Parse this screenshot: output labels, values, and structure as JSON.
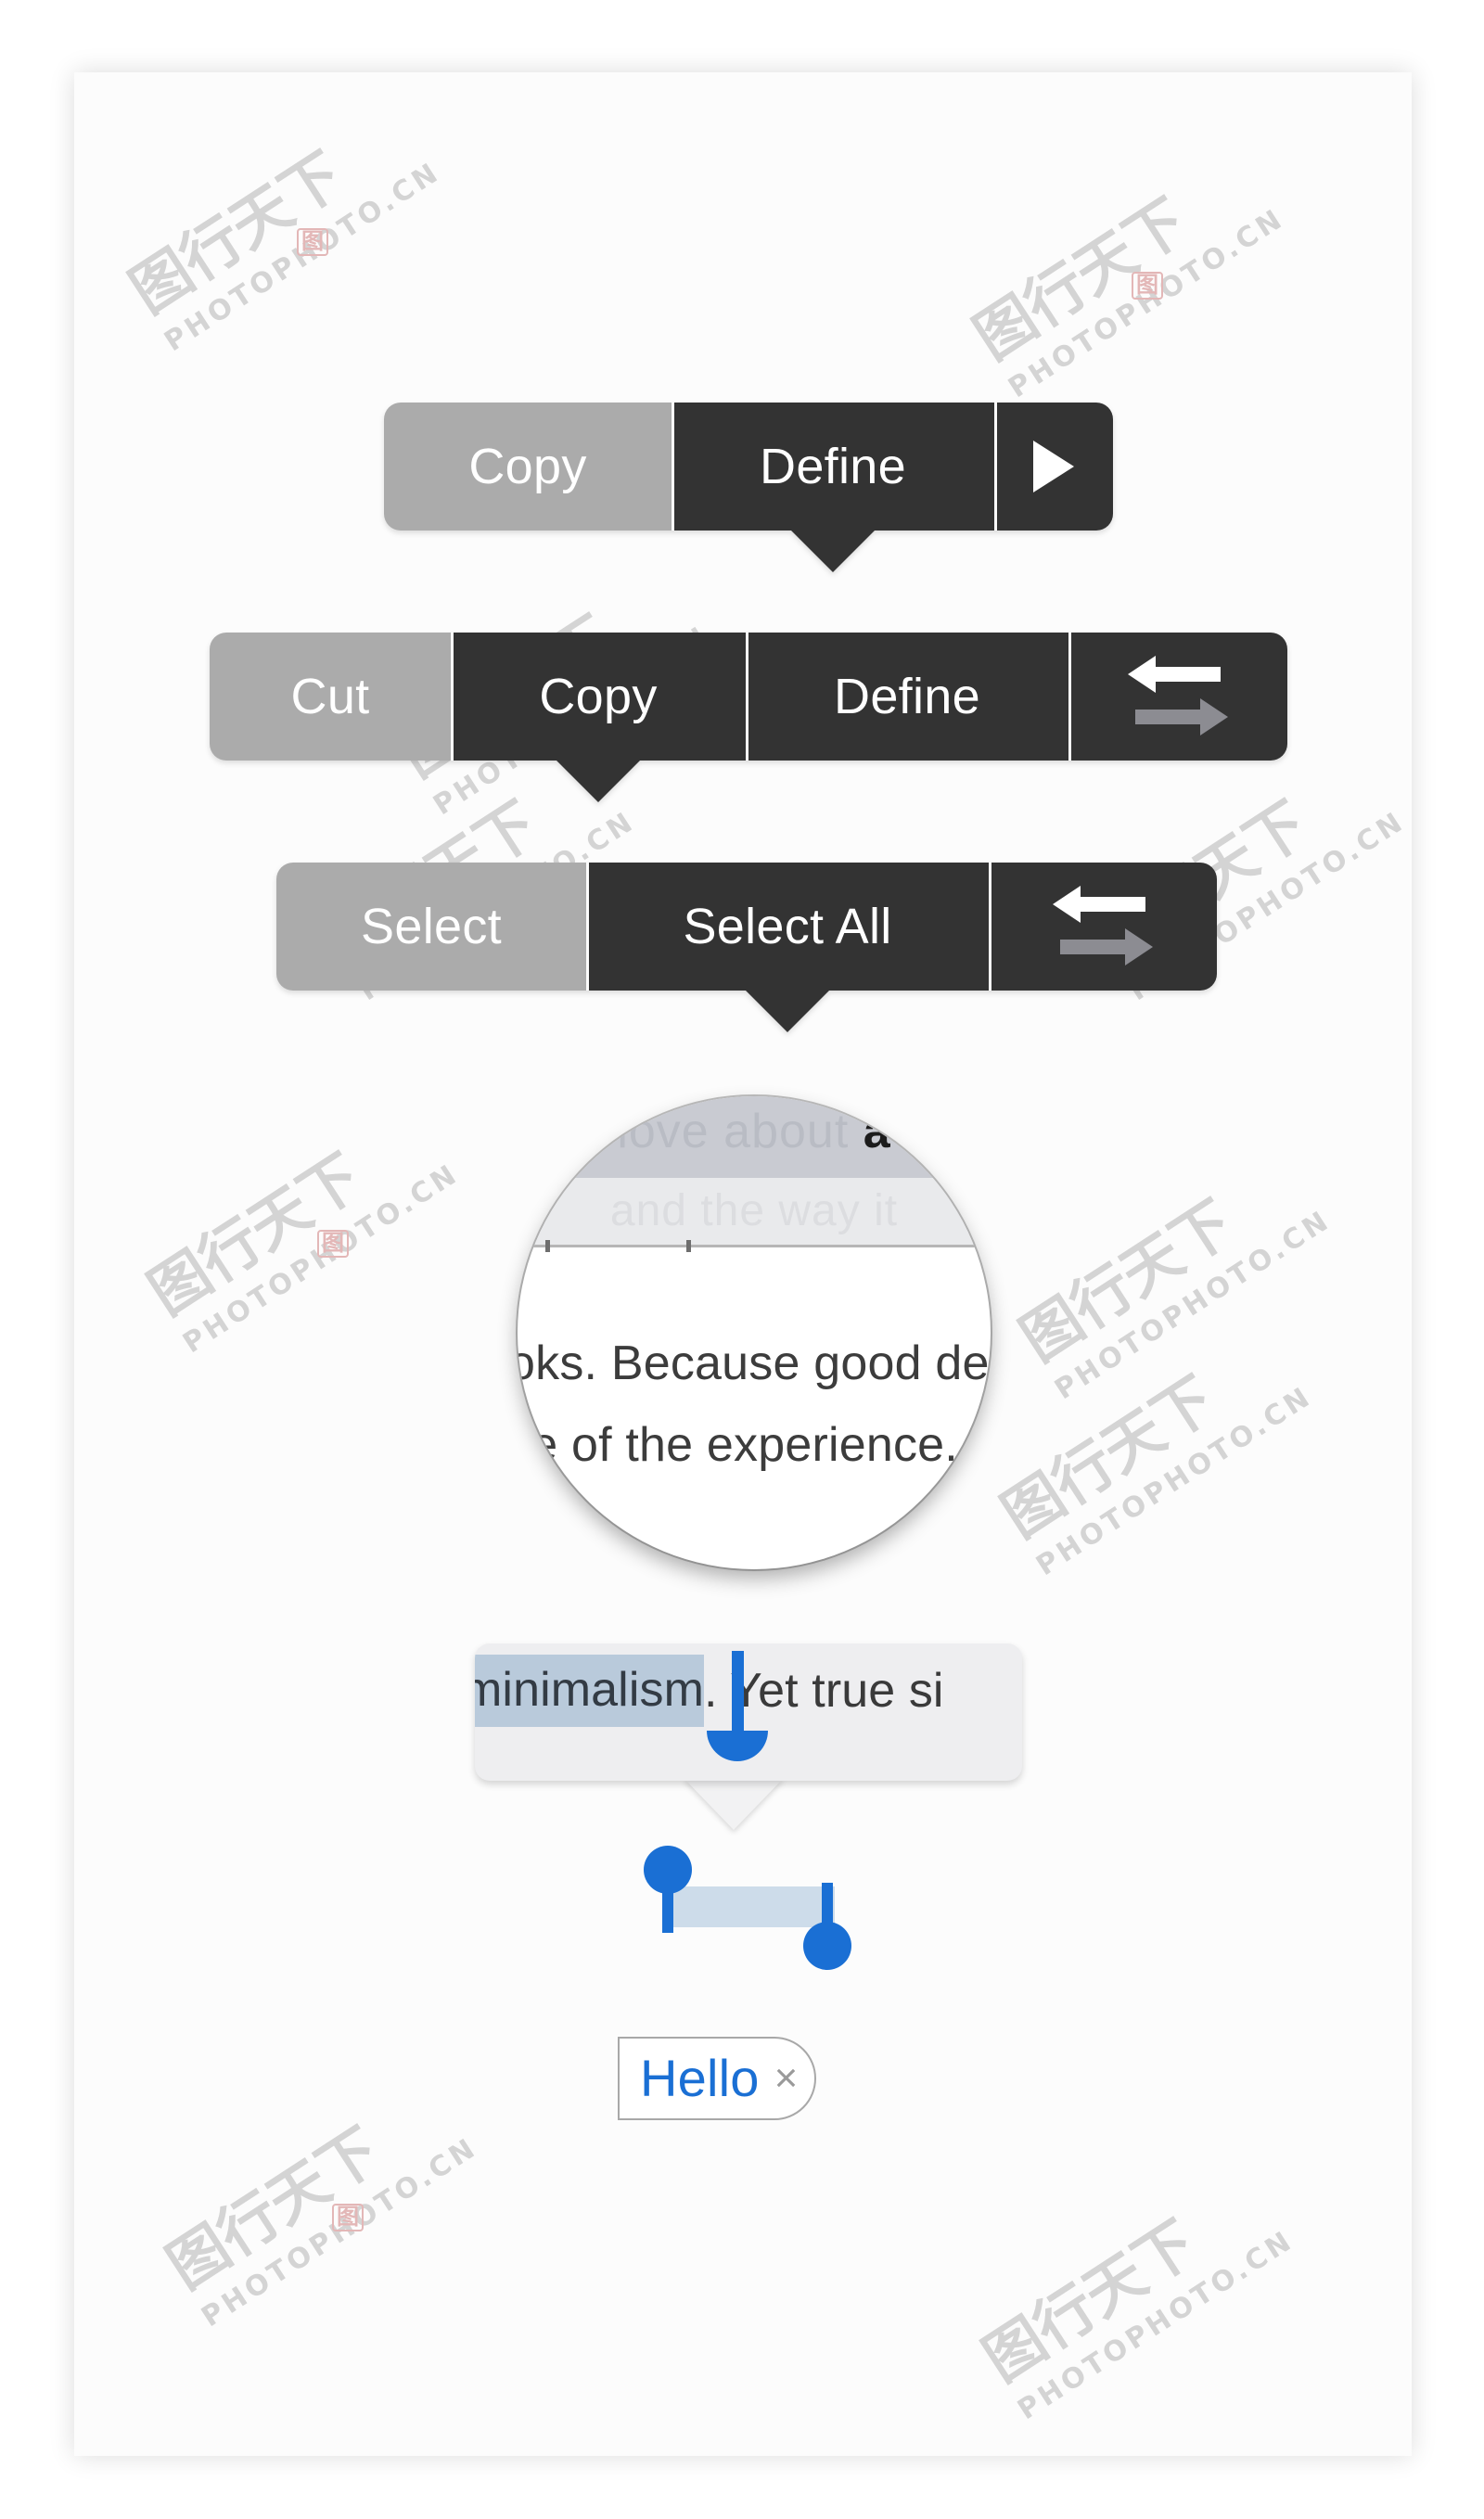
{
  "artboard": {
    "background_color": "#fcfcfc",
    "page_background": "#ffffff"
  },
  "theme": {
    "dark_segment": "#333333",
    "highlight_segment": "#ababab",
    "label_color": "#ffffff",
    "accent_blue": "#1a6fd4",
    "selection_fill": "#b9cadb",
    "selection_band": "#cddcea",
    "token_text": "#1a6fd4",
    "token_border": "#a8a8a8"
  },
  "watermark": {
    "cjk": "图行天下",
    "latin": "PHOTOPHOTO.CN",
    "stamp": "图"
  },
  "menus": [
    {
      "id": "menu-copy-define",
      "segments": [
        {
          "label": "Copy",
          "state": "highlighted",
          "kind": "text"
        },
        {
          "label": "Define",
          "state": "normal",
          "kind": "text",
          "has_tail": true
        },
        {
          "label": "",
          "state": "normal",
          "kind": "icon",
          "icon": "triangle-right-icon"
        }
      ]
    },
    {
      "id": "menu-cut-copy-define",
      "segments": [
        {
          "label": "Cut",
          "state": "highlighted",
          "kind": "text"
        },
        {
          "label": "Copy",
          "state": "normal",
          "kind": "text",
          "has_tail": true
        },
        {
          "label": "Define",
          "state": "normal",
          "kind": "text"
        },
        {
          "label": "",
          "state": "normal",
          "kind": "icon",
          "icon": "arrows-left-right-icon"
        }
      ]
    },
    {
      "id": "menu-select",
      "segments": [
        {
          "label": "Select",
          "state": "highlighted",
          "kind": "text"
        },
        {
          "label": "Select All",
          "state": "normal",
          "kind": "text",
          "has_tail": true
        },
        {
          "label": "",
          "state": "normal",
          "kind": "icon",
          "icon": "arrows-left-right-icon"
        }
      ]
    }
  ],
  "loupe": {
    "ghost_top_faint": "love about",
    "ghost_top_dark": "a",
    "ghost_mid": "and the way it",
    "line1": "oks. Because good desig",
    "line2": "ce of the experience."
  },
  "selection_bubble": {
    "selected_text": "minimalism",
    "trailing_text": ". Yet true si"
  },
  "token": {
    "label": "Hello",
    "close_icon": "×"
  }
}
